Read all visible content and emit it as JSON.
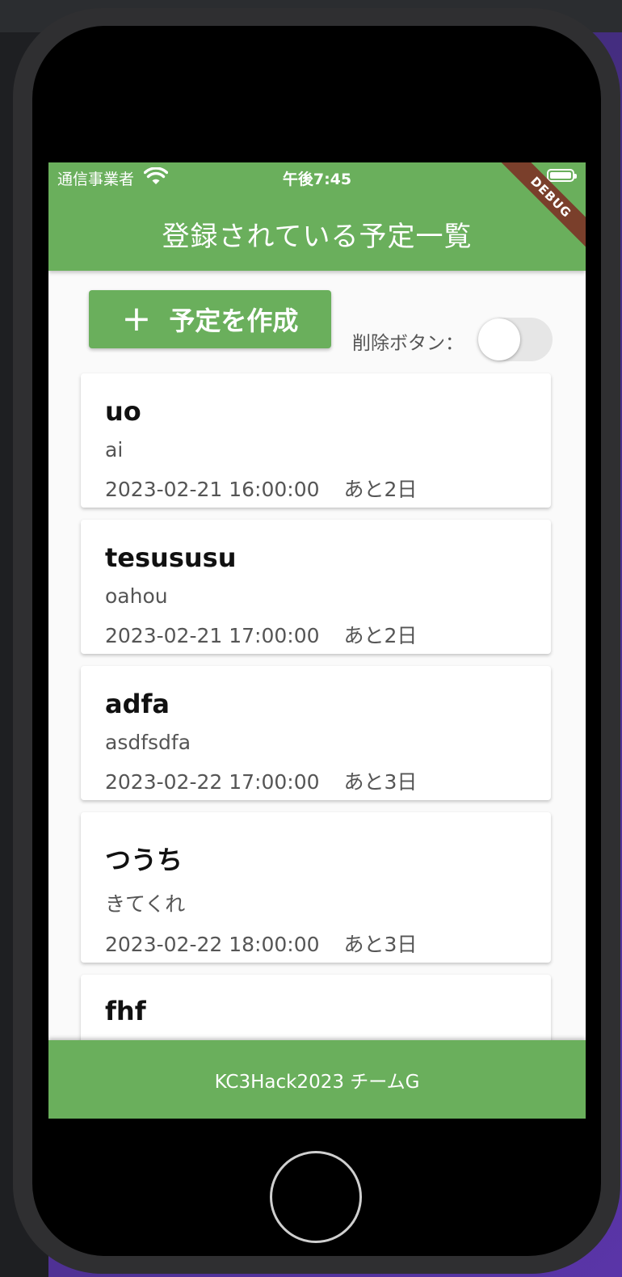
{
  "status_bar": {
    "carrier": "通信事業者",
    "time": "午後7:45"
  },
  "app_bar": {
    "title": "登録されている予定一覧",
    "debug_banner": "DEBUG"
  },
  "controls": {
    "create_button_icon": "+",
    "create_button_label": "予定を作成",
    "delete_toggle_label": "削除ボタン：",
    "delete_toggle_on": false
  },
  "schedules": [
    {
      "title": "uo",
      "description": "ai",
      "datetime": "2023-02-21 16:00:00",
      "remaining": "あと2日"
    },
    {
      "title": "tesususu",
      "description": "oahou",
      "datetime": "2023-02-21 17:00:00",
      "remaining": "あと2日"
    },
    {
      "title": "adfa",
      "description": "asdfsdfa",
      "datetime": "2023-02-22 17:00:00",
      "remaining": "あと3日"
    },
    {
      "title": "つうち",
      "description": "きてくれ",
      "datetime": "2023-02-22 18:00:00",
      "remaining": "あと3日"
    },
    {
      "title": "fhf",
      "description": "",
      "datetime": "",
      "remaining": ""
    }
  ],
  "footer": {
    "text": "KC3Hack2023 チームG"
  },
  "colors": {
    "primary": "#6aaf5c",
    "debug_banner": "#7a3f2b",
    "background": "#fafafa"
  }
}
